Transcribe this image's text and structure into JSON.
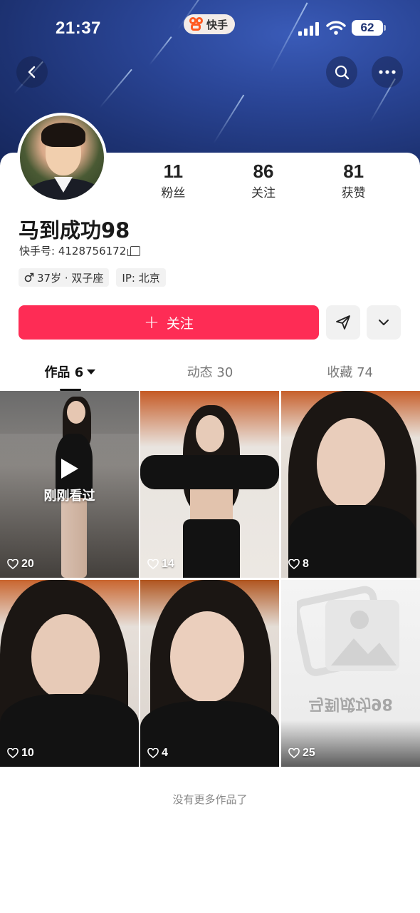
{
  "status_bar": {
    "time": "21:37",
    "app_name": "快手",
    "battery": "62"
  },
  "header": {
    "back_icon": "chevron-left-icon",
    "search_icon": "search-icon",
    "more_icon": "more-dots-icon"
  },
  "profile": {
    "name": "马到成功98",
    "kuaishou_id": "快手号: 4128756172",
    "tags": [
      "37岁 · 双子座",
      "IP: 北京"
    ],
    "stats": [
      {
        "value": "11",
        "label": "粉丝"
      },
      {
        "value": "86",
        "label": "关注"
      },
      {
        "value": "81",
        "label": "获赞"
      }
    ]
  },
  "actions": {
    "follow_label": "关注",
    "accent_color": "#fe2c55"
  },
  "tabs": [
    {
      "label": "作品 6",
      "active": true
    },
    {
      "label": "动态 30",
      "active": false
    },
    {
      "label": "收藏 74",
      "active": false
    }
  ],
  "works": [
    {
      "likes": "20",
      "overlay": "刚刚看过"
    },
    {
      "likes": "14"
    },
    {
      "likes": "8"
    },
    {
      "likes": "10"
    },
    {
      "likes": "4"
    },
    {
      "likes": "25",
      "placeholder_caption": "马到成功98"
    }
  ],
  "footer_note": "没有更多作品了"
}
